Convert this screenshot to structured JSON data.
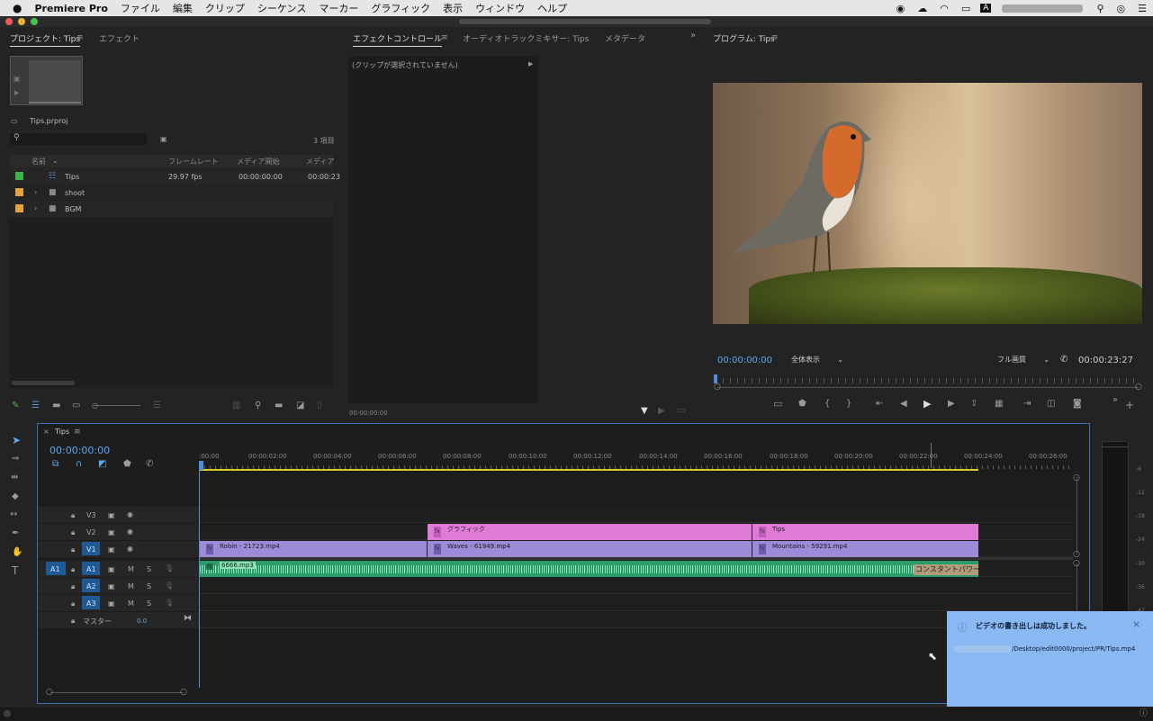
{
  "menubar": {
    "app": "Premiere Pro",
    "items": [
      "ファイル",
      "編集",
      "クリップ",
      "シーケンス",
      "マーカー",
      "グラフィック",
      "表示",
      "ウィンドウ",
      "ヘルプ"
    ],
    "input_indicator": "A"
  },
  "project_panel": {
    "tabs": [
      "プロジェクト: Tips",
      "エフェクト"
    ],
    "project_file": "Tips.prproj",
    "item_count": "3 項目",
    "columns": [
      "名前",
      "フレームレート",
      "メディア開始",
      "メディア"
    ],
    "rows": [
      {
        "name": "Tips",
        "fps": "29.97 fps",
        "start": "00:00:00:00",
        "end": "00:00:23",
        "color": "#3fb24c"
      },
      {
        "name": "shoot",
        "fps": "",
        "start": "",
        "end": "",
        "color": "#e4a23a"
      },
      {
        "name": "BGM",
        "fps": "",
        "start": "",
        "end": "",
        "color": "#e4a23a"
      }
    ]
  },
  "effect_controls": {
    "tabs": [
      "エフェクトコントロール",
      "オーディオトラックミキサー: Tips",
      "メタデータ"
    ],
    "no_clip": "(クリップが選択されていません)",
    "timecode": "00:00:00:00"
  },
  "program_monitor": {
    "title": "プログラム: Tips",
    "timecode": "00:00:00:00",
    "zoom": "全体表示",
    "quality": "フル画質",
    "duration": "00:00:23:27"
  },
  "timeline": {
    "sequence_tab": "Tips",
    "timecode": "00:00:00:00",
    "ruler": [
      ":00:00",
      "00:00:02:00",
      "00:00:04:00",
      "00:00:06:00",
      "00:00:08:00",
      "00:00:10:00",
      "00:00:12:00",
      "00:00:14:00",
      "00:00:16:00",
      "00:00:18:00",
      "00:00:20:00",
      "00:00:22:00",
      "00:00:24:00",
      "00:00:26:00"
    ],
    "video_tracks": [
      "V3",
      "V2",
      "V1"
    ],
    "audio_tracks": [
      "A1",
      "A2",
      "A3"
    ],
    "source_patch": "A1",
    "master_label": "マスター",
    "master_value": "0.0",
    "track_buttons": {
      "mute": "M",
      "solo": "S"
    },
    "clips": {
      "v2_graphic": "グラフィック",
      "v2_tips": "Tips",
      "v1_robin": "Robin - 21723.mp4",
      "v1_waves": "Waves - 61949.mp4",
      "v1_mountains": "Mountains - 59291.mp4",
      "a1_audio": "6666.mp3",
      "a1_transition": "コンスタントパワー"
    },
    "meter_scale": [
      "-6",
      "-12",
      "-18",
      "-24",
      "-30",
      "-36",
      "-42"
    ]
  },
  "toast": {
    "message": "ビデオの書き出しは成功しました。",
    "path": "/Desktop/edit0000/project/PR/Tips.mp4"
  }
}
